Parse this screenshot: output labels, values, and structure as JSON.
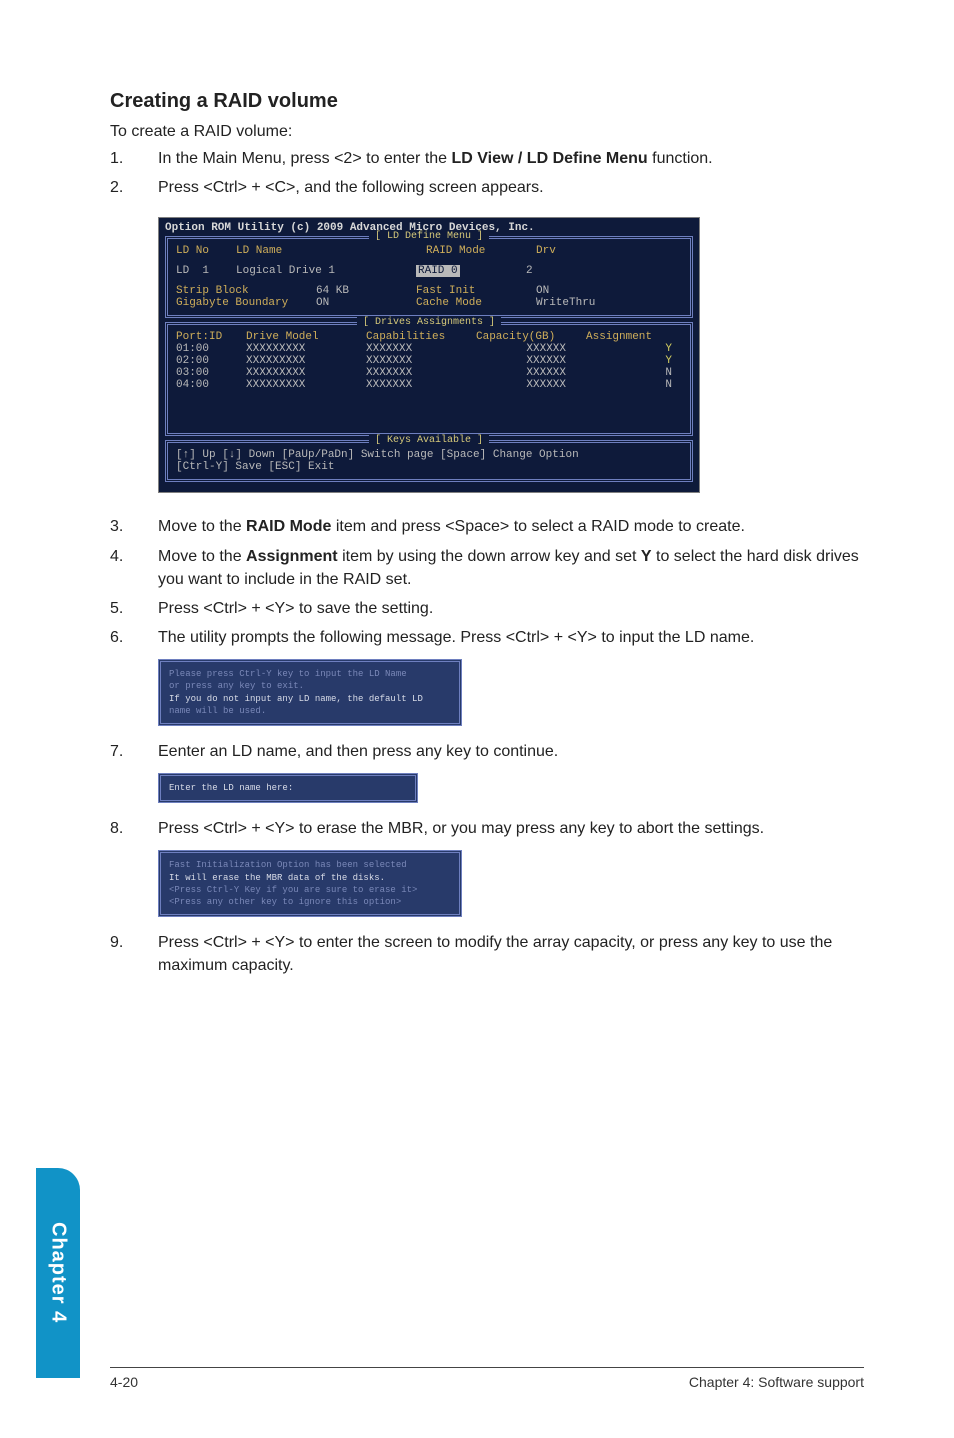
{
  "section_title": "Creating a RAID volume",
  "intro": "To create a RAID volume:",
  "steps_top": [
    {
      "num": "1.",
      "html_key": "step1"
    },
    {
      "num": "2.",
      "html_key": "step2"
    }
  ],
  "step1_pre": "In the Main Menu, press <2> to enter the ",
  "step1_bold": "LD View / LD Define Menu",
  "step1_post": " function.",
  "step2": "Press <Ctrl> + <C>, and the following screen appears.",
  "bios_title": "Option ROM Utility (c) 2009 Advanced Micro Devices, Inc.",
  "bios_box1_caption": "[ LD Define Menu ]",
  "bios_box1": {
    "r1_labels": [
      "LD No",
      "LD Name",
      "RAID Mode",
      "Drv"
    ],
    "r2": {
      "ld": "LD  1",
      "name": "Logical Drive 1",
      "mode": "RAID 0",
      "drv": "2"
    },
    "r3a": {
      "lbl": "Strip Block",
      "val": "64 KB"
    },
    "r3b": {
      "lbl": "Fast Init",
      "val": "ON"
    },
    "r4a": {
      "lbl": "Gigabyte Boundary",
      "val": "ON"
    },
    "r4b": {
      "lbl": "Cache Mode",
      "val": "WriteThru"
    }
  },
  "bios_box2_caption": "[ Drives Assignments ]",
  "bios_box2_headers": [
    "Port:ID",
    "Drive Model",
    "Capabilities",
    "Capacity(GB)",
    "Assignment"
  ],
  "bios_box2_rows": [
    {
      "port": "01:00",
      "model": "XXXXXXXXX",
      "cap": "XXXXXXX",
      "gb": "XXXXXX",
      "assign": "Y"
    },
    {
      "port": "02:00",
      "model": "XXXXXXXXX",
      "cap": "XXXXXXX",
      "gb": "XXXXXX",
      "assign": "Y"
    },
    {
      "port": "03:00",
      "model": "XXXXXXXXX",
      "cap": "XXXXXXX",
      "gb": "XXXXXX",
      "assign": "N"
    },
    {
      "port": "04:00",
      "model": "XXXXXXXXX",
      "cap": "XXXXXXX",
      "gb": "XXXXXX",
      "assign": "N"
    }
  ],
  "bios_box3_caption": "[ Keys Available ]",
  "bios_keys_l1": "[↑] Up  [↓] Down  [PaUp/PaDn] Switch page  [Space] Change Option",
  "bios_keys_l2": "[Ctrl-Y] Save  [ESC] Exit",
  "step3_num": "3.",
  "step3_pre": "Move to the ",
  "step3_bold": "RAID Mode",
  "step3_post": " item and press <Space> to select a RAID mode to create.",
  "step4_num": "4.",
  "step4_pre": "Move to the ",
  "step4_bold1": "Assignment",
  "step4_mid": " item by using the down arrow key and set ",
  "step4_bold2": "Y",
  "step4_post": " to select the hard disk drives you want to include in the RAID set.",
  "step5_num": "5.",
  "step5": "Press <Ctrl> + <Y> to save the setting.",
  "step6_num": "6.",
  "step6": "The utility prompts the following message. Press <Ctrl> + <Y> to input the LD name.",
  "term1_l1": "Please press Ctrl-Y key to input the LD Name",
  "term1_l2": "or press any key to exit.",
  "term1_l3": "If you do not input any LD name, the default LD",
  "term1_l4": "name will be used.",
  "step7_num": "7.",
  "step7": "Eenter an LD name, and then press any key to continue.",
  "term2_l1": "Enter the LD name here:",
  "step8_num": "8.",
  "step8": "Press <Ctrl> + <Y> to erase the MBR, or you may press any key to abort the settings.",
  "term3_l1": "Fast Initialization Option has been selected",
  "term3_l2": "It will erase the MBR data of the disks.",
  "term3_l3": "<Press Ctrl-Y Key if you are sure to erase it>",
  "term3_l4": "<Press any other key to ignore this option>",
  "step9_num": "9.",
  "step9": "Press <Ctrl> + <Y> to enter the screen to modify the array capacity, or press any key to use the maximum capacity.",
  "side_tab": "Chapter 4",
  "footer_left": "4-20",
  "footer_right": "Chapter 4: Software support"
}
